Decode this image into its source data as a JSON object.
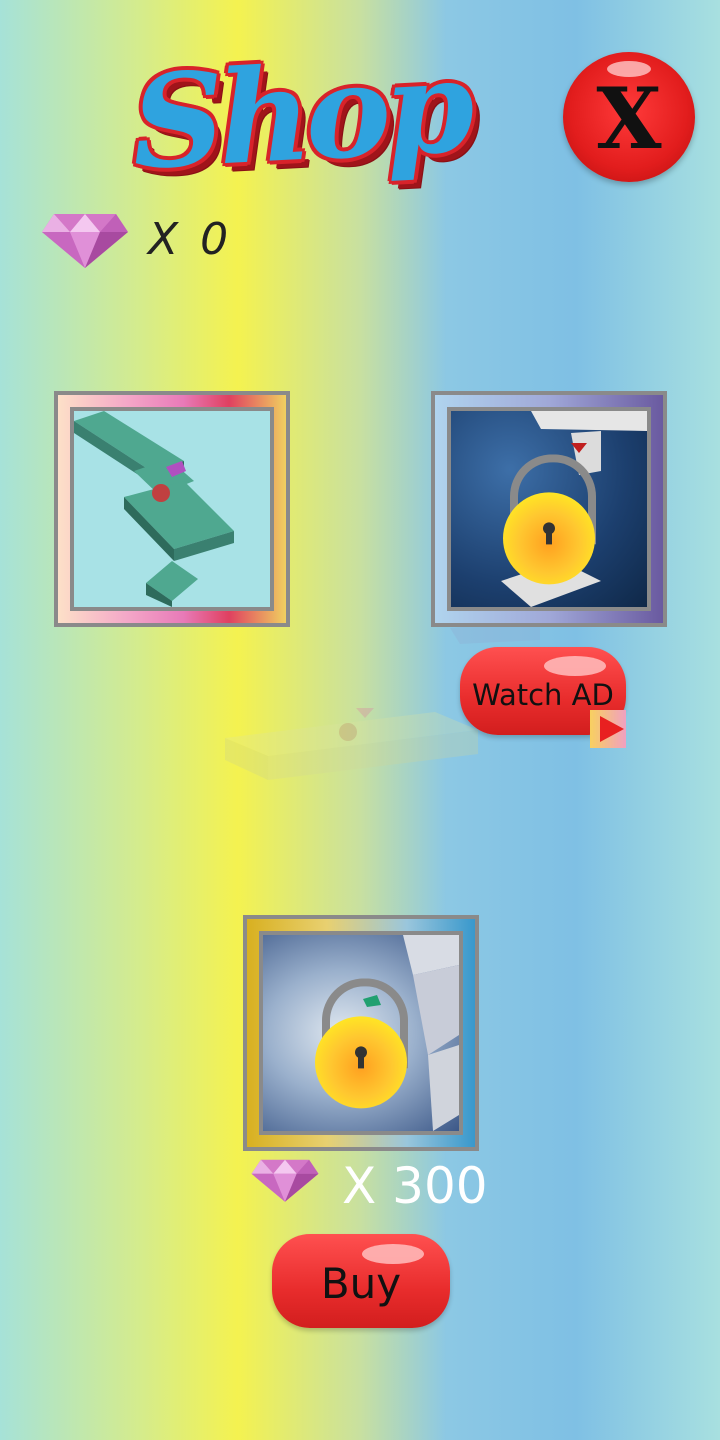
{
  "header": {
    "title": "Shop",
    "close_label": "X"
  },
  "gems": {
    "count_label": "X 0",
    "gem_icon": "diamond-icon",
    "gem_color": "#d070c0"
  },
  "items": [
    {
      "id": "skin-green-path",
      "state": "unlocked"
    },
    {
      "id": "skin-ocean",
      "state": "locked",
      "action_label": "Watch AD"
    },
    {
      "id": "skin-ice",
      "state": "locked",
      "price_label": "X 300",
      "action_label": "Buy"
    }
  ],
  "colors": {
    "button_red": "#e82c2c",
    "title_blue": "#2fa3df",
    "title_red": "#d8232a"
  }
}
